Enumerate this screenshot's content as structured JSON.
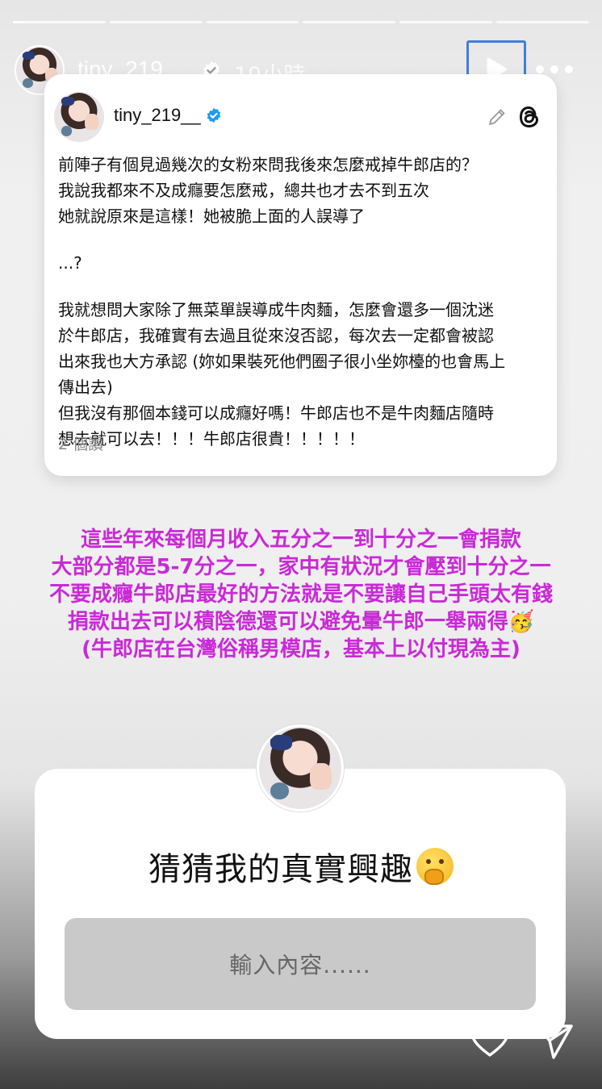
{
  "story": {
    "segments": [
      1,
      0,
      0,
      0,
      0,
      0
    ],
    "active_progress": 0.12
  },
  "header": {
    "username": "tiny_219__",
    "time_ago": "19小時"
  },
  "threads_post": {
    "username": "tiny_219__",
    "lines": [
      "前陣子有個見過幾次的女粉來問我後來怎麼戒掉牛郎店的？",
      "我說我都來不及成癮要怎麼戒，總共也才去不到五次",
      "她就說原來是這樣！她被脆上面的人誤導了",
      "",
      "...?",
      "",
      "我就想問大家除了無菜單誤導成牛肉麵，怎麼會還多一個沈迷",
      "於牛郎店，我確實有去過且從來沒否認，每次去一定都會被認",
      "出來我也大方承認 (妳如果裝死他們圈子很小坐妳檯的也會馬上",
      "傳出去)",
      "但我沒有那個本錢可以成癮好嗎！牛郎店也不是牛肉麵店隨時",
      "想去就可以去！！！牛郎店很貴！！！！！"
    ],
    "read_count": "2 個讀"
  },
  "caption": {
    "lines": [
      "這些年來每個月收入五分之一到十分之一會捐款",
      "大部分都是5-7分之一，家中有狀況才會壓到十分之一",
      "不要成癮牛郎店最好的方法就是不要讓自己手頭太有錢",
      "捐款出去可以積陰德還可以避免暈牛郎一舉兩得🥳",
      "(牛郎店在台灣俗稱男模店，基本上以付現為主)"
    ]
  },
  "question_sticker": {
    "title": "猜猜我的真實興趣",
    "placeholder": "輸入內容......"
  },
  "icons": {
    "verified": "verified-badge-icon",
    "play": "play-icon",
    "more": "more-icon",
    "pencil": "pencil-icon",
    "threads": "threads-logo-icon",
    "heart": "heart-icon",
    "send": "send-icon"
  },
  "colors": {
    "caption": "#c92ad6",
    "highlight_box": "#3d7fe0",
    "verified_blue": "#1d9bf0"
  }
}
